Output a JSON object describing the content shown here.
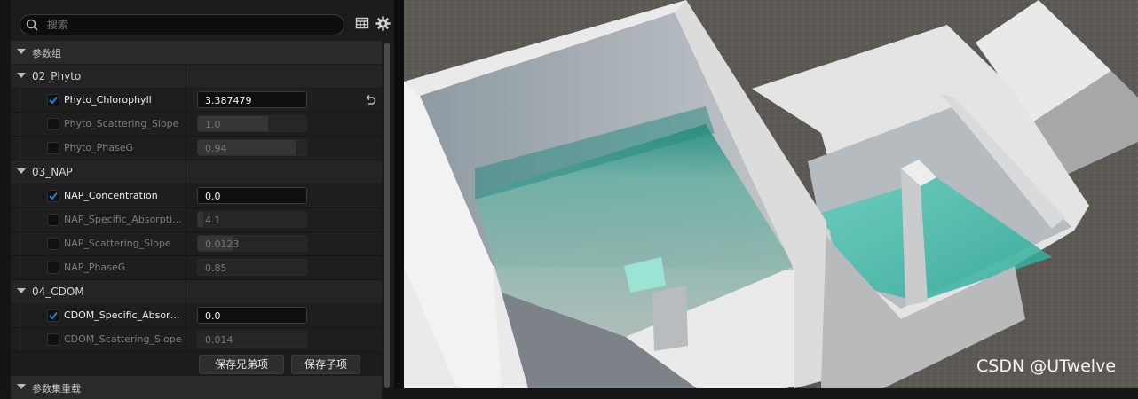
{
  "search": {
    "placeholder": "搜索"
  },
  "toolbar": {
    "table_icon": "table-icon",
    "settings_icon": "gear-icon"
  },
  "section_param_group": {
    "label": "参数组"
  },
  "groups": [
    {
      "label": "02_Phyto"
    },
    {
      "label": "03_NAP"
    },
    {
      "label": "04_CDOM"
    }
  ],
  "properties": [
    {
      "name": "Phyto_Chlorophyll",
      "value": "3.387479",
      "enabled": true,
      "fill": 0
    },
    {
      "name": "Phyto_Scattering_Slope",
      "value": "1.0",
      "enabled": false,
      "fill": 0.65
    },
    {
      "name": "Phyto_PhaseG",
      "value": "0.94",
      "enabled": false,
      "fill": 0.9
    },
    {
      "name": "NAP_Concentration",
      "value": "0.0",
      "enabled": true,
      "fill": 0
    },
    {
      "name": "NAP_Specific_Absorption_",
      "value": "4.1",
      "enabled": false,
      "fill": 0.05
    },
    {
      "name": "NAP_Scattering_Slope",
      "value": "0.0123",
      "enabled": false,
      "fill": 0.33
    },
    {
      "name": "NAP_PhaseG",
      "value": "0.85",
      "enabled": false,
      "fill": 0.0
    },
    {
      "name": "CDOM_Specific_Absorpti...",
      "value": "0.0",
      "enabled": true,
      "fill": 0
    },
    {
      "name": "CDOM_Scattering_Slope",
      "value": "0.014",
      "enabled": false,
      "fill": 0.0
    }
  ],
  "buttons": {
    "save_siblings": "保存兄弟项",
    "save_child": "保存子项"
  },
  "section_param_set": {
    "label": "参数集重载"
  },
  "watermark": "CSDN @UTwelve",
  "colors": {
    "accent": "#1a7fe0",
    "water": "#47c5b4"
  }
}
